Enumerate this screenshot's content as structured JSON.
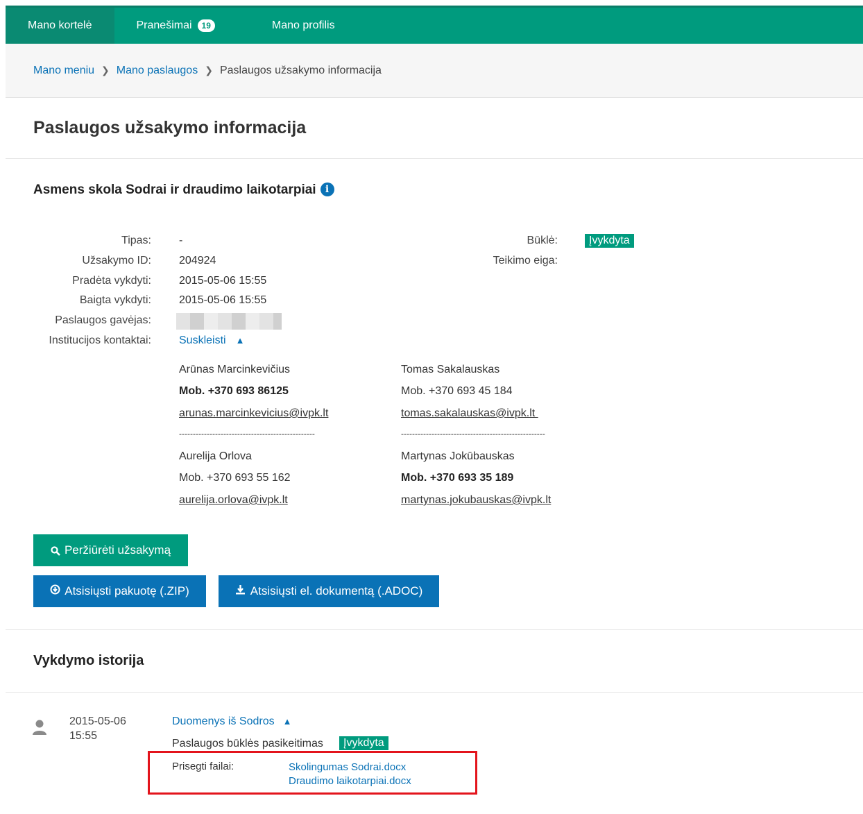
{
  "nav": {
    "items": [
      {
        "label": "Mano kortelė"
      },
      {
        "label": "Pranešimai",
        "badge": "19"
      },
      {
        "label": "Mano profilis"
      }
    ]
  },
  "breadcrumb": {
    "items": [
      "Mano meniu",
      "Mano paslaugos",
      "Paslaugos užsakymo informacija"
    ]
  },
  "page": {
    "title": "Paslaugos užsakymo informacija"
  },
  "service": {
    "title": "Asmens skola Sodrai ir draudimo laikotarpiai",
    "fields": {
      "type_label": "Tipas:",
      "type_value": "-",
      "order_id_label": "Užsakymo ID:",
      "order_id_value": "204924",
      "started_label": "Pradėta vykdyti:",
      "started_value": "2015-05-06 15:55",
      "finished_label": "Baigta vykdyti:",
      "finished_value": "2015-05-06 15:55",
      "recipient_label": "Paslaugos gavėjas:",
      "contacts_label": "Institucijos kontaktai:",
      "contacts_toggle": "Suskleisti",
      "status_label": "Būklė:",
      "status_value": "Įvykdyta",
      "progress_label": "Teikimo eiga:"
    },
    "contacts": [
      {
        "name": "Arūnas Marcinkevičius",
        "phone": "Mob. +370 693 86125",
        "email": "arunas.marcinkevicius@ivpk.lt"
      },
      {
        "name": "Tomas Sakalauskas",
        "phone": "Mob. +370 693 45 184",
        "email": "tomas.sakalauskas@ivpk.lt "
      },
      {
        "name": "Aurelija Orlova",
        "phone": "Mob. +370 693 55 162",
        "email": "aurelija.orlova@ivpk.lt"
      },
      {
        "name": "Martynas Jokūbauskas",
        "phone": "Mob. +370 693 35 189",
        "email": "martynas.jokubauskas@ivpk.lt"
      }
    ],
    "separator_left": "-------------------------------------------------",
    "separator_right": "----------------------------------------------------",
    "buttons": {
      "view_order": "Peržiūrėti užsakymą",
      "download_zip": "Atsisiųsti pakuotę (.ZIP)",
      "download_adoc": "Atsisiųsti el. dokumentą (.ADOC)"
    }
  },
  "history": {
    "title": "Vykdymo istorija",
    "entry": {
      "date": "2015-05-06",
      "time": "15:55",
      "source": "Duomenys iš Sodros",
      "change_text": "Paslaugos būklės pasikeitimas",
      "status": "Įvykdyta",
      "attached_label": "Prisegti failai:",
      "files": [
        "Skolingumas Sodrai.docx",
        "Draudimo laikotarpiai.docx"
      ]
    }
  },
  "colors": {
    "accent": "#009b7e",
    "link": "#0a72b6",
    "highlight": "#e3141c"
  }
}
